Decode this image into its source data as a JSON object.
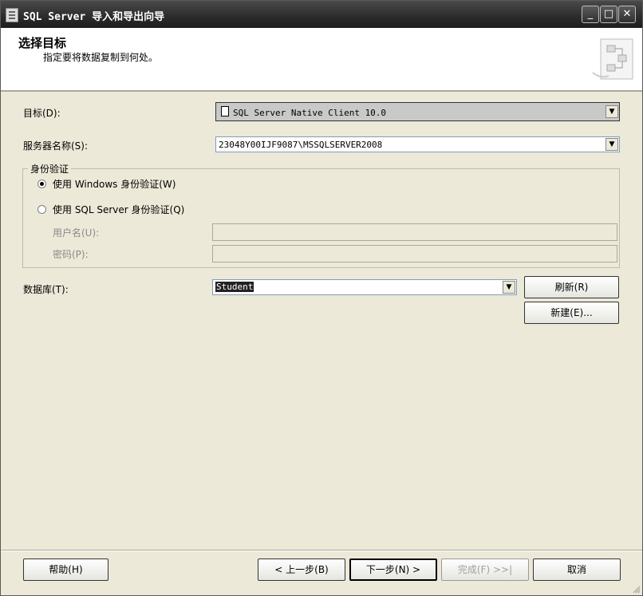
{
  "window": {
    "title": "SQL Server 导入和导出向导",
    "minimize": "_",
    "maximize": "□",
    "close": "✕"
  },
  "header": {
    "title": "选择目标",
    "subtitle": "指定要将数据复制到何处。"
  },
  "destination": {
    "label": "目标(D):",
    "value": "SQL Server Native Client 10.0"
  },
  "server": {
    "label": "服务器名称(S):",
    "value": "23048Y00IJF9087\\MSSQLSERVER2008"
  },
  "auth": {
    "group_title": "身份验证",
    "windows_label": "使用 Windows 身份验证(W)",
    "sql_label": "使用 SQL Server 身份验证(Q)",
    "username_label": "用户名(U):",
    "password_label": "密码(P):",
    "username_value": "",
    "password_value": "",
    "selected": "windows"
  },
  "database": {
    "label": "数据库(T):",
    "value": "Student",
    "refresh_button": "刷新(R)",
    "new_button": "新建(E)..."
  },
  "footer": {
    "help": "帮助(H)",
    "back": "< 上一步(B)",
    "next": "下一步(N) >",
    "finish": "完成(F) >>|",
    "cancel": "取消"
  }
}
